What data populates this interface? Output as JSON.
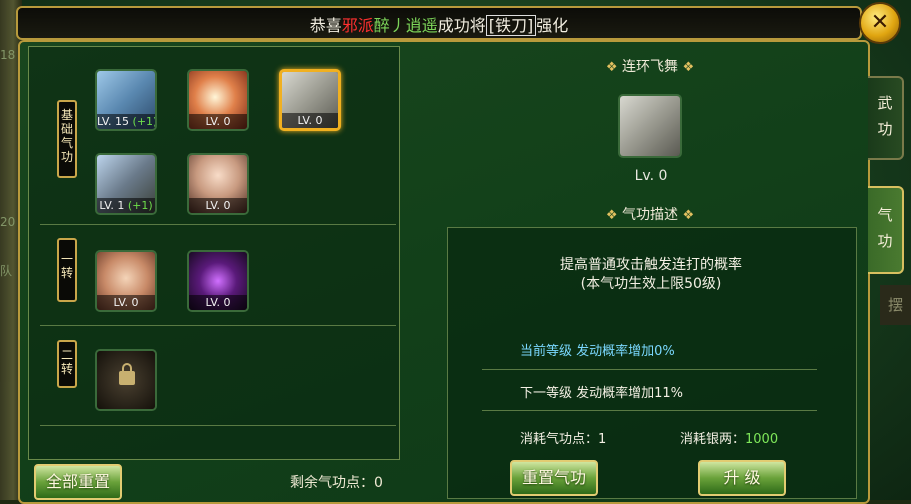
{
  "banner": {
    "prefix": "恭喜",
    "faction": "邪派",
    "player": "醉丿逍遥",
    "middle": "成功将",
    "item": "[铁刀]",
    "suffix": "强化"
  },
  "close_glyph": "✕",
  "left_edge_text": [
    "18",
    "20",
    "队"
  ],
  "rows": [
    {
      "label": "基础气功"
    },
    {
      "label": "一转"
    },
    {
      "label": "二转"
    }
  ],
  "skills": [
    {
      "lv": "LV. 15",
      "plus": "(+1)",
      "icon": "fist-icon"
    },
    {
      "lv": "LV. 0",
      "plus": "",
      "icon": "sword-slash-icon"
    },
    {
      "lv": "LV. 0",
      "plus": "",
      "icon": "scroll-icon"
    },
    {
      "lv": "LV. 1",
      "plus": "(+1)",
      "icon": "armor-icon"
    },
    {
      "lv": "LV. 0",
      "plus": "",
      "icon": "warrior-face-icon"
    },
    {
      "lv": "LV. 0",
      "plus": "",
      "icon": "palm-icon"
    },
    {
      "lv": "LV. 0",
      "plus": "",
      "icon": "purple-orb-icon"
    },
    {
      "lv": "",
      "plus": "",
      "icon": "lock-icon"
    }
  ],
  "footer": {
    "reset_all": "全部重置",
    "remaining_label": "剩余气功点：",
    "remaining_value": "0"
  },
  "detail": {
    "skill_name": "连环飞舞",
    "skill_level": "Lv. 0",
    "desc_title": "气功描述",
    "desc_line1": "提高普通攻击触发连打的概率",
    "desc_line2": "(本气功生效上限50级)",
    "current_level": "当前等级  发动概率增加0%",
    "next_level": "下一等级  发动概率增加11%",
    "cost_points_label": "消耗气功点：",
    "cost_points_value": "1",
    "cost_silver_label": "消耗银两：",
    "cost_silver_value": "1000",
    "reset_btn": "重置气功",
    "upgrade_btn": "升  级"
  },
  "tabs": [
    {
      "label": "武功",
      "active": false
    },
    {
      "label": "气功",
      "active": true
    }
  ],
  "tab_peek": "摆"
}
